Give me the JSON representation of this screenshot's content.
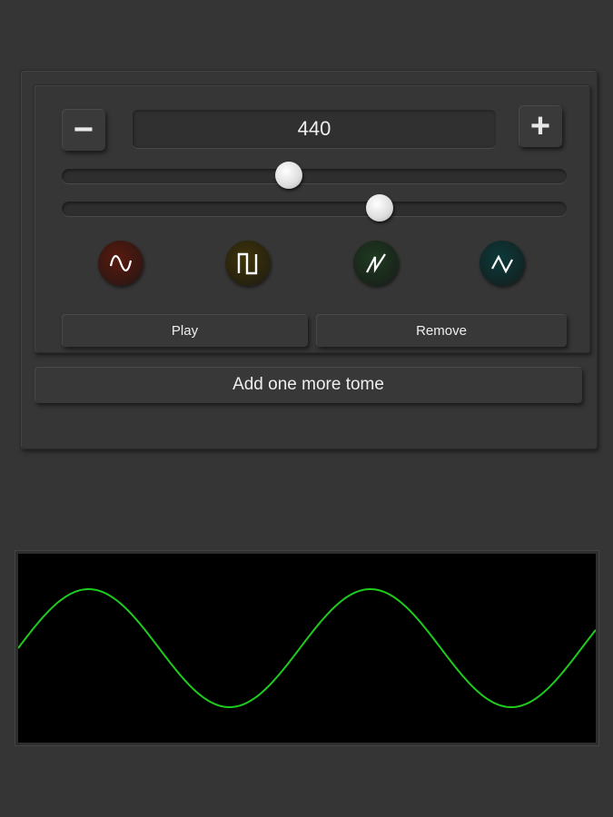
{
  "tone": {
    "decrement_label": "−",
    "frequency": "440",
    "increment_label": "+",
    "slider1_value": 0.45,
    "slider2_value": 0.63,
    "waveforms": [
      {
        "name": "sine",
        "color": "#5a1a0e"
      },
      {
        "name": "square",
        "color": "#3f3408"
      },
      {
        "name": "sawtooth",
        "color": "#1f3a22"
      },
      {
        "name": "triangle",
        "color": "#0d3a3a"
      }
    ],
    "play_label": "Play",
    "remove_label": "Remove"
  },
  "add_label": "Add one more tome",
  "scope": {
    "wave_color": "#1ecc1e",
    "cycles": 2.05
  }
}
